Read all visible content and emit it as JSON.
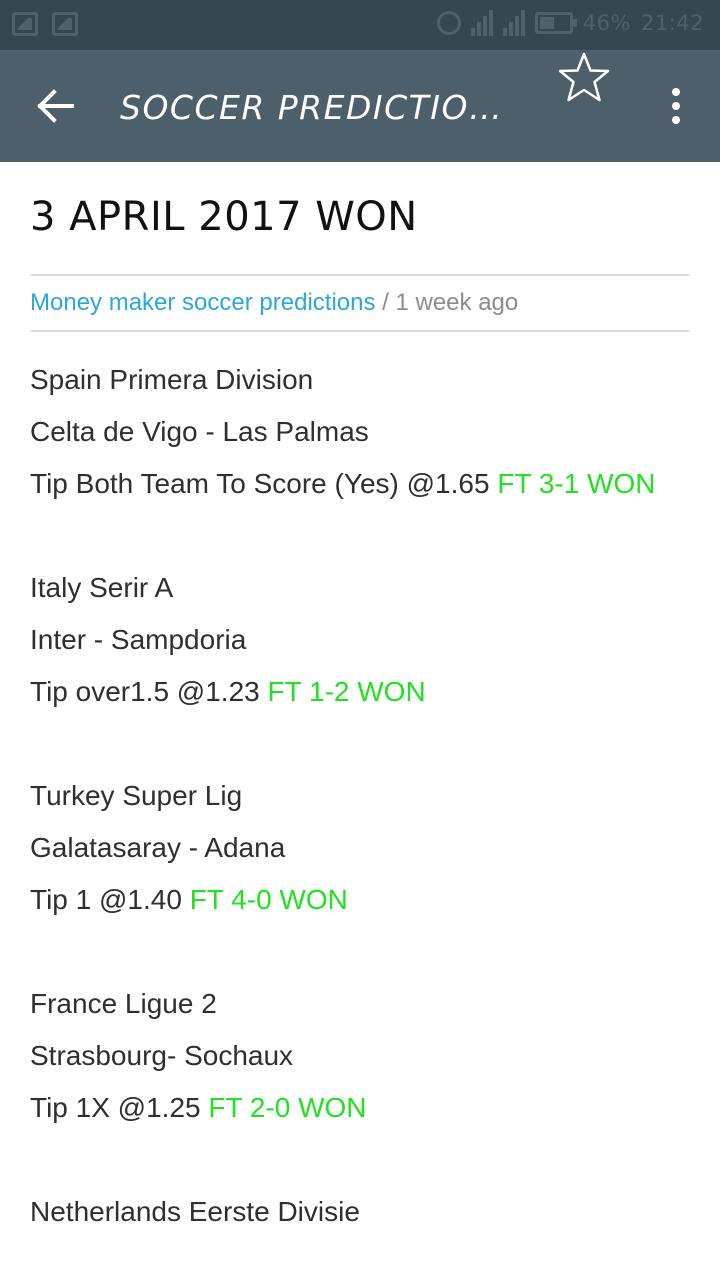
{
  "status_bar": {
    "battery": "46%",
    "time": "21:42"
  },
  "app_bar": {
    "title": "SOCCER PREDICTION...",
    "back_icon": "back-arrow-icon",
    "star_icon": "star-outline-icon",
    "menu_icon": "more-vert-icon"
  },
  "post": {
    "title": "3 APRIL 2017 WON",
    "author": "Money maker soccer predictions",
    "separator": "/",
    "time_ago": "1 week ago",
    "matches": [
      {
        "league": "Spain Primera Division",
        "teams": "Celta de Vigo - Las Palmas",
        "tip": "Tip Both Team To Score (Yes) @1.65 ",
        "result": "FT 3-1 WON"
      },
      {
        "league": "Italy Serir A",
        "teams": "Inter - Sampdoria",
        "tip": "Tip over1.5 @1.23 ",
        "result": "FT 1-2 WON"
      },
      {
        "league": "Turkey Super Lig",
        "teams": "Galatasaray - Adana",
        "tip": "Tip 1 @1.40 ",
        "result": "FT 4-0 WON"
      },
      {
        "league": "France Ligue 2",
        "teams": "Strasbourg- Sochaux",
        "tip": "Tip 1X @1.25 ",
        "result": "FT 2-0 WON"
      },
      {
        "league": "Netherlands Eerste Divisie"
      }
    ]
  },
  "colors": {
    "app_bar": "#4c5f6a",
    "status_bar": "#374750",
    "link": "#2aa8d9",
    "result": "#22e022"
  }
}
